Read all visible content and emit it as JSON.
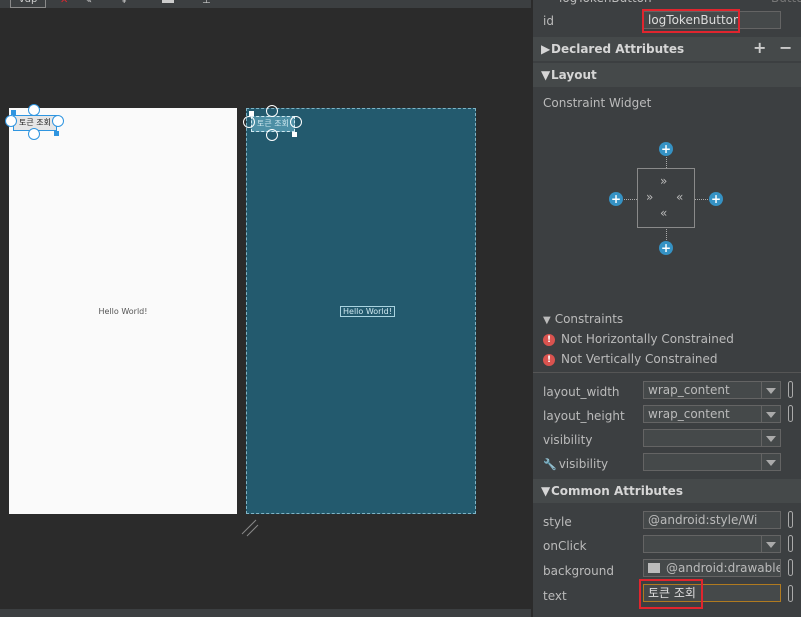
{
  "toolbar": {
    "device_label": "vdp"
  },
  "design": {
    "button_text": "토큰 조회",
    "hello_text": "Hello World!"
  },
  "blueprint": {
    "button_text": "토큰 조회",
    "hello_text": "Hello World!"
  },
  "panel": {
    "header_title": "logTokenButton",
    "header_type": "Button",
    "id_label": "id",
    "id_value": "logTokenButton",
    "declared_attributes": "Declared Attributes",
    "layout_section": "Layout",
    "constraint_widget": "Constraint Widget",
    "constraints_title": "Constraints",
    "constraint_warnings": [
      "Not Horizontally Constrained",
      "Not Vertically Constrained"
    ],
    "layout_width_label": "layout_width",
    "layout_width_value": "wrap_content",
    "layout_height_label": "layout_height",
    "layout_height_value": "wrap_content",
    "visibility_label": "visibility",
    "visibility_value": "",
    "tools_visibility_label": "visibility",
    "tools_visibility_value": "",
    "common_attributes": "Common Attributes",
    "style_label": "style",
    "style_value": "@android:style/Wi",
    "onclick_label": "onClick",
    "onclick_value": "",
    "background_label": "background",
    "background_value": "@android:drawable/b",
    "text_label": "text",
    "text_value": "토큰 조회"
  },
  "colors": {
    "highlight": "#e0252e",
    "blueprint_bg": "#235a6e",
    "selection": "#2f95e0",
    "constraint_plus": "#3592c4"
  }
}
